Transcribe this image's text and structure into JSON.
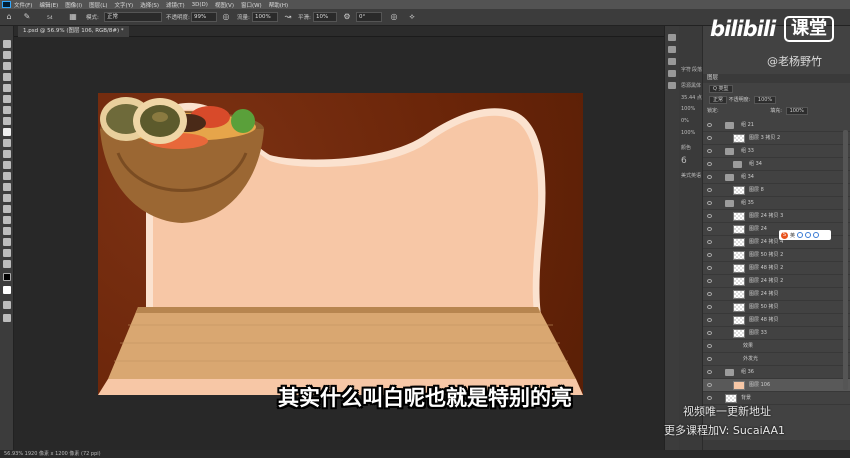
{
  "menubar": {
    "items": [
      "文件(F)",
      "编辑(E)",
      "图像(I)",
      "图层(L)",
      "文字(Y)",
      "选择(S)",
      "滤镜(T)",
      "3D(D)",
      "视图(V)",
      "窗口(W)",
      "帮助(H)"
    ]
  },
  "options": {
    "brush_size": "54",
    "mode_label": "模式:",
    "mode_value": "正常",
    "opacity_label": "不透明度:",
    "opacity_value": "99%",
    "flow_label": "流量:",
    "flow_value": "100%",
    "smooth_label": "平滑:",
    "smooth_value": "10%",
    "angle_value": "0°"
  },
  "document": {
    "tab_title": "1.psd @ 56.9% (图层 106, RGB/8#) *"
  },
  "status": {
    "text": "56.93%    1920 像素 x 1200 像素 (72 ppi)"
  },
  "subtitle": "其实什么叫白呢也就是特别的亮",
  "watermark": {
    "brand": "bilibili",
    "brand_suffix": "课堂",
    "user": "@老杨野竹",
    "line1": "视频唯一更新地址",
    "line2": "更多课程加V: SucaiAA1"
  },
  "properties": {
    "labels": [
      "字符",
      "段落",
      "思源黑体",
      "35.44 点",
      "100%",
      "0%",
      "100%",
      "6",
      "颜色",
      "美式英语"
    ]
  },
  "layers": {
    "header": "图层",
    "filter_label": "Q 类型",
    "blend_mode": "正常",
    "opacity_label": "不透明度:",
    "opacity_value": "100%",
    "lock_label": "锁定:",
    "fill_label": "填充:",
    "fill_value": "100%",
    "rows": [
      {
        "name": "组 21",
        "kind": "folder",
        "indent": 1
      },
      {
        "name": "图层 3 拷贝 2",
        "kind": "layer",
        "indent": 2
      },
      {
        "name": "组 33",
        "kind": "folder",
        "indent": 1
      },
      {
        "name": "组 34",
        "kind": "folder",
        "indent": 2
      },
      {
        "name": "组 34",
        "kind": "folder",
        "indent": 1
      },
      {
        "name": "图层 8",
        "kind": "layer",
        "indent": 2
      },
      {
        "name": "组 35",
        "kind": "folder",
        "indent": 1
      },
      {
        "name": "图层 24 拷贝 3",
        "kind": "layer",
        "indent": 2
      },
      {
        "name": "图层 24",
        "kind": "layer",
        "indent": 2
      },
      {
        "name": "图层 24 拷贝 4",
        "kind": "layer",
        "indent": 2
      },
      {
        "name": "图层 50 拷贝 2",
        "kind": "layer",
        "indent": 2
      },
      {
        "name": "图层 48 拷贝 2",
        "kind": "layer",
        "indent": 2
      },
      {
        "name": "图层 24 拷贝 2",
        "kind": "layer",
        "indent": 2
      },
      {
        "name": "图层 24 拷贝",
        "kind": "layer",
        "indent": 2
      },
      {
        "name": "图层 50 拷贝",
        "kind": "layer",
        "indent": 2
      },
      {
        "name": "图层 48 拷贝",
        "kind": "layer",
        "indent": 2
      },
      {
        "name": "图层 33",
        "kind": "layer",
        "indent": 2
      },
      {
        "name": "效果",
        "kind": "effect",
        "indent": 3
      },
      {
        "name": "外发光",
        "kind": "effect",
        "indent": 3
      },
      {
        "name": "组 36",
        "kind": "folder",
        "indent": 1
      },
      {
        "name": "图层 106",
        "kind": "layer",
        "indent": 2,
        "selected": true
      },
      {
        "name": "背景",
        "kind": "layer",
        "indent": 1
      }
    ]
  },
  "colors": {
    "canvas_bg": "#6e2a0d",
    "cat_shape": "#f7c7a6",
    "cat_outline": "#fbe2cf",
    "sun": "#e35a32",
    "table": "#d9a771",
    "selected_layer": "#595959"
  }
}
